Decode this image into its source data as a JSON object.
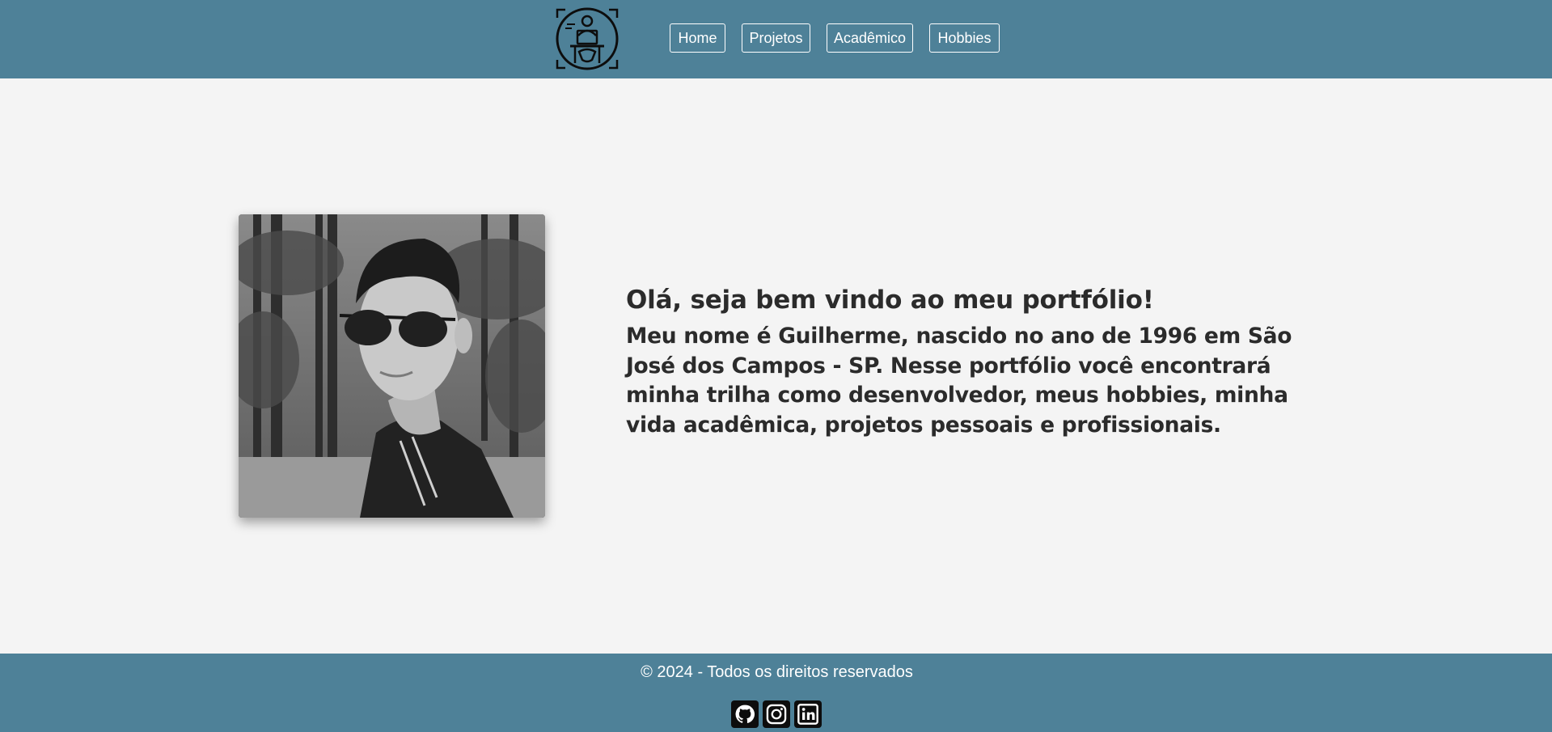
{
  "header": {
    "logo_icon": "developer-at-laptop-icon",
    "nav": [
      {
        "label": "Home"
      },
      {
        "label": "Projetos"
      },
      {
        "label": "Acadêmico"
      },
      {
        "label": "Hobbies"
      }
    ]
  },
  "intro": {
    "heading": "Olá, seja bem vindo ao meu portfólio!",
    "text": "Meu nome é Guilherme, nascido no ano de 1996 em São José dos Campos - SP. Nesse portfólio você encontrará minha trilha como desenvolvedor, meus hobbies, minha vida acadêmica, projetos pessoais e profissionais."
  },
  "profile_photo": {
    "icon": "profile-photo"
  },
  "footer": {
    "copyright": "© 2024 - Todos os direitos reservados",
    "social": [
      {
        "icon": "github-icon"
      },
      {
        "icon": "instagram-icon"
      },
      {
        "icon": "linkedin-icon"
      }
    ]
  },
  "colors": {
    "bar": "#4e8198",
    "background": "#f4f4f4",
    "text": "#2b2b2b",
    "nav_text": "#ffffff"
  }
}
